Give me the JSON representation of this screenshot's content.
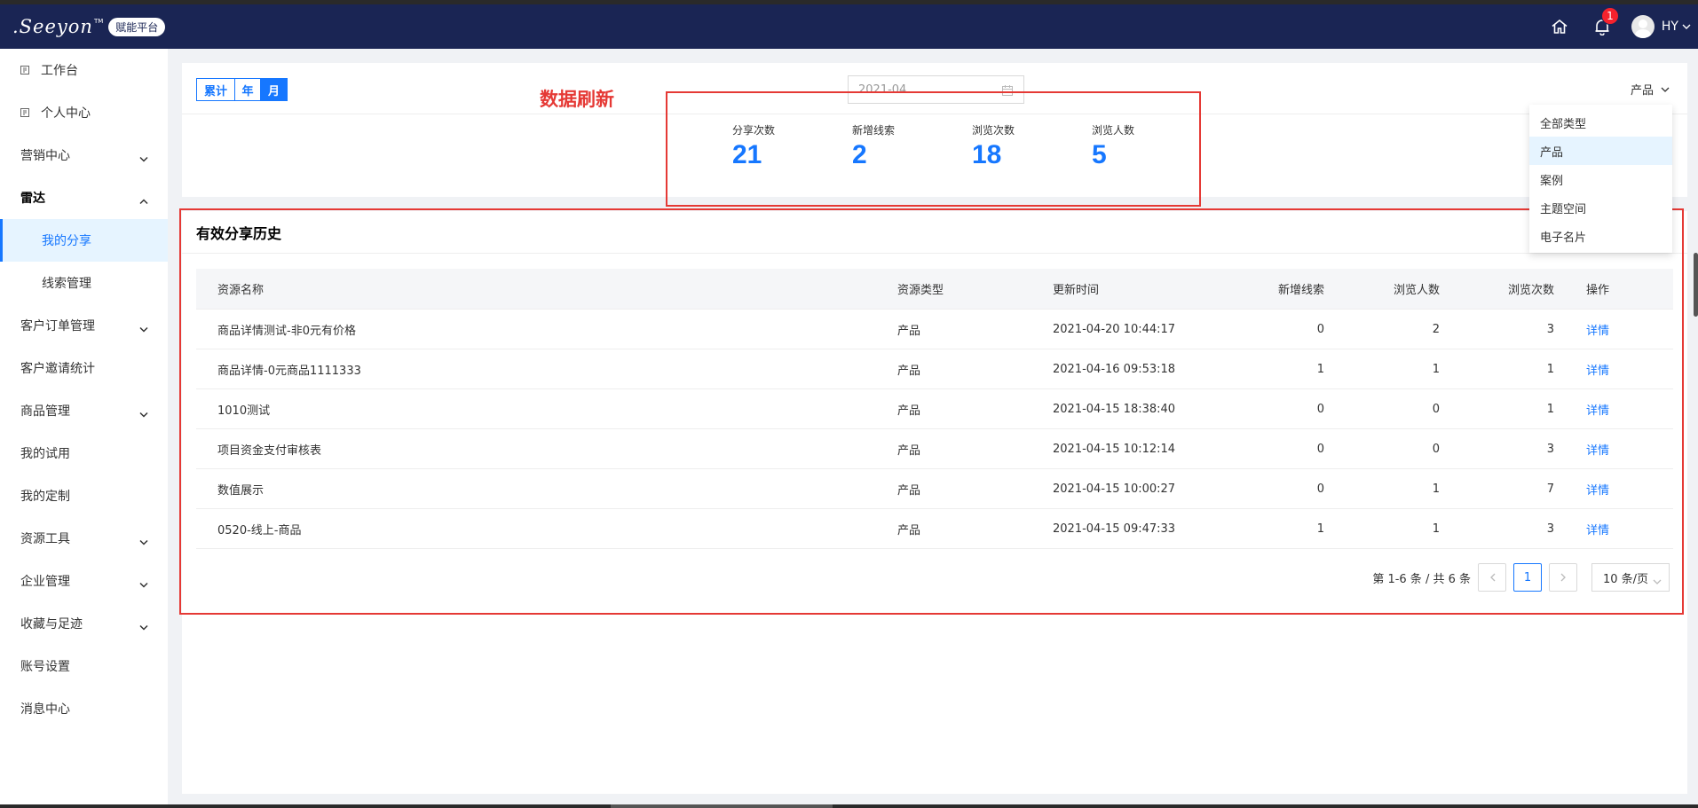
{
  "header": {
    "logo_text": ".Seeyon",
    "logo_tm": "TM",
    "platform_badge": "赋能平台",
    "notification_count": "1",
    "user_name": "HY"
  },
  "sidebar": {
    "items": [
      {
        "label": "工作台"
      },
      {
        "label": "个人中心"
      },
      {
        "label": "营销中心"
      },
      {
        "label": "雷达"
      },
      {
        "label": "我的分享"
      },
      {
        "label": "线索管理"
      },
      {
        "label": "客户订单管理"
      },
      {
        "label": "客户邀请统计"
      },
      {
        "label": "商品管理"
      },
      {
        "label": "我的试用"
      },
      {
        "label": "我的定制"
      },
      {
        "label": "资源工具"
      },
      {
        "label": "企业管理"
      },
      {
        "label": "收藏与足迹"
      },
      {
        "label": "账号设置"
      },
      {
        "label": "消息中心"
      }
    ]
  },
  "filters": {
    "segments": [
      "累计",
      "年",
      "月"
    ],
    "date_value": "2021-04",
    "type_select": "产品"
  },
  "stats": {
    "share_count_label": "分享次数",
    "share_count": "21",
    "new_leads_label": "新增线索",
    "new_leads": "2",
    "views_label": "浏览次数",
    "views": "18",
    "viewers_label": "浏览人数",
    "viewers": "5"
  },
  "annotation": {
    "text": "数据刷新"
  },
  "type_dropdown": {
    "options": [
      "全部类型",
      "产品",
      "案例",
      "主题空间",
      "电子名片"
    ]
  },
  "history": {
    "title": "有效分享历史",
    "columns": [
      "资源名称",
      "资源类型",
      "更新时间",
      "新增线索",
      "浏览人数",
      "浏览次数",
      "操作"
    ],
    "rows": [
      {
        "name": "商品详情测试-非0元有价格",
        "type": "产品",
        "time": "2021-04-20 10:44:17",
        "leads": "0",
        "viewers": "2",
        "views": "3",
        "action": "详情"
      },
      {
        "name": "商品详情-0元商品1111333",
        "type": "产品",
        "time": "2021-04-16 09:53:18",
        "leads": "1",
        "viewers": "1",
        "views": "1",
        "action": "详情"
      },
      {
        "name": "1010测试",
        "type": "产品",
        "time": "2021-04-15 18:38:40",
        "leads": "0",
        "viewers": "0",
        "views": "1",
        "action": "详情"
      },
      {
        "name": "项目资金支付审核表",
        "type": "产品",
        "time": "2021-04-15 10:12:14",
        "leads": "0",
        "viewers": "0",
        "views": "3",
        "action": "详情"
      },
      {
        "name": "数值展示",
        "type": "产品",
        "time": "2021-04-15 10:00:27",
        "leads": "0",
        "viewers": "1",
        "views": "7",
        "action": "详情"
      },
      {
        "name": "0520-线上-商品",
        "type": "产品",
        "time": "2021-04-15 09:47:33",
        "leads": "1",
        "viewers": "1",
        "views": "3",
        "action": "详情"
      }
    ]
  },
  "pagination": {
    "summary": "第 1-6 条 / 共 6 条",
    "current_page": "1",
    "page_size": "10 条/页"
  },
  "colors": {
    "header_bg": "#1a2554",
    "accent": "#1677ff",
    "annotation": "#e53935"
  }
}
